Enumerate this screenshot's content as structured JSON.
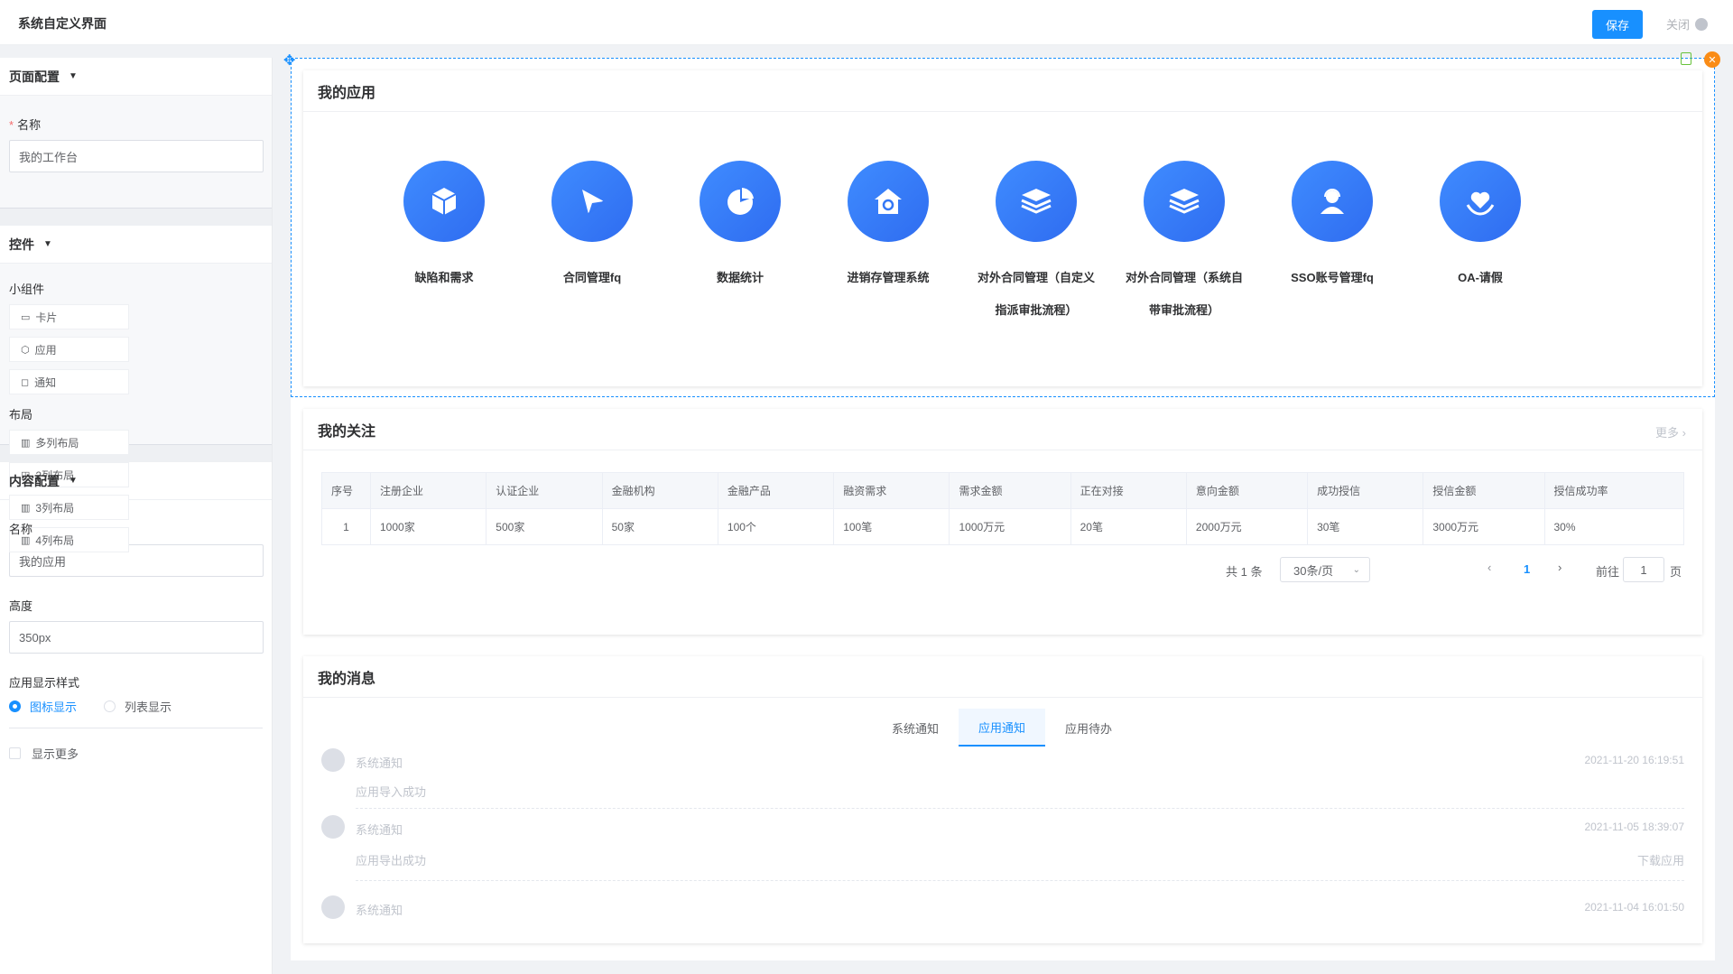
{
  "header": {
    "title": "系统自定义界面",
    "save_label": "保存",
    "close_label": "关闭"
  },
  "left": {
    "page_config": {
      "title": "页面配置",
      "name_label": "名称",
      "name_value": "我的工作台"
    },
    "controls": {
      "title": "控件",
      "widgets_label": "小组件",
      "widgets": [
        {
          "label": "卡片",
          "icon": "card-icon"
        },
        {
          "label": "应用",
          "icon": "cube-icon"
        },
        {
          "label": "通知",
          "icon": "bell-icon"
        }
      ],
      "layout_label": "布局",
      "layouts": [
        {
          "label": "多列布局"
        },
        {
          "label": "2列布局"
        },
        {
          "label": "3列布局"
        },
        {
          "label": "4列布局"
        }
      ]
    },
    "content_config": {
      "title": "内容配置",
      "name_label": "名称",
      "name_value": "我的应用",
      "height_label": "高度",
      "height_value": "350px",
      "style_label": "应用显示样式",
      "style_options": [
        "图标显示",
        "列表显示"
      ],
      "show_more_label": "显示更多"
    }
  },
  "apps_card": {
    "title": "我的应用",
    "apps": [
      {
        "name": "缺陷和需求",
        "icon": "cube-icon"
      },
      {
        "name": "合同管理fq",
        "icon": "send-icon"
      },
      {
        "name": "数据统计",
        "icon": "pie-icon"
      },
      {
        "name": "进销存管理系统",
        "icon": "house-icon"
      },
      {
        "name": "对外合同管理（自定义指派审批流程）",
        "icon": "layers-icon"
      },
      {
        "name": "对外合同管理（系统自带审批流程）",
        "icon": "layers-icon"
      },
      {
        "name": "SSO账号管理fq",
        "icon": "user-headset-icon"
      },
      {
        "name": "OA-请假",
        "icon": "heart-hand-icon"
      }
    ]
  },
  "follow_card": {
    "title": "我的关注",
    "more_label": "更多",
    "columns": [
      "序号",
      "注册企业",
      "认证企业",
      "金融机构",
      "金融产品",
      "融资需求",
      "需求金额",
      "正在对接",
      "意向金额",
      "成功授信",
      "授信金额",
      "授信成功率"
    ],
    "rows": [
      [
        "1",
        "1000家",
        "500家",
        "50家",
        "100个",
        "100笔",
        "1000万元",
        "20笔",
        "2000万元",
        "30笔",
        "3000万元",
        "30%"
      ]
    ],
    "pager": {
      "total": "共 1 条",
      "page_size": "30条/页",
      "current": "1",
      "goto_label": "前往",
      "goto_value": "1",
      "page_suffix": "页"
    }
  },
  "msg_card": {
    "title": "我的消息",
    "tabs": [
      "系统通知",
      "应用通知",
      "应用待办"
    ],
    "messages": [
      {
        "source": "系统通知",
        "time": "2021-11-20 16:19:51",
        "body": "应用导入成功",
        "action": ""
      },
      {
        "source": "系统通知",
        "time": "2021-11-05 18:39:07",
        "body": "应用导出成功",
        "action": "下载应用"
      },
      {
        "source": "系统通知",
        "time": "2021-11-04 16:01:50",
        "body": "",
        "action": ""
      }
    ]
  },
  "colors": {
    "primary": "#1890ff",
    "app_icon": "#3478f6",
    "delete": "#fa8c16"
  }
}
